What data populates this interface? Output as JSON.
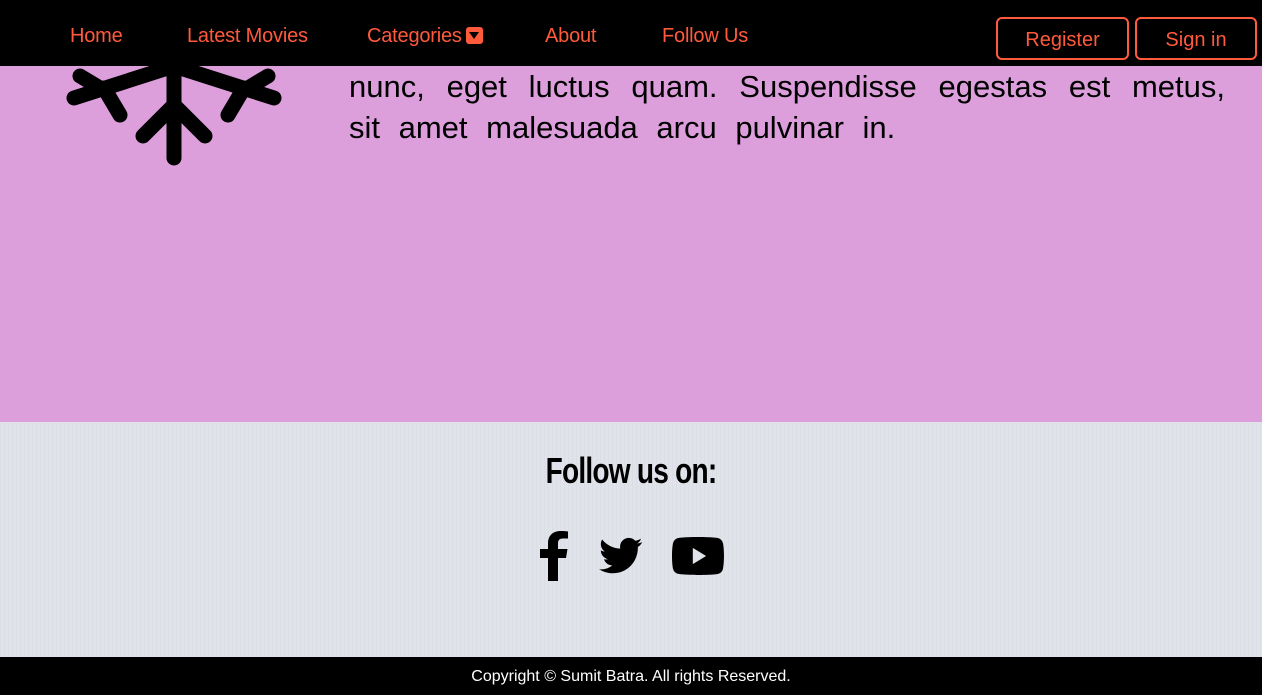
{
  "navbar": {
    "links": [
      "Home",
      "Latest Movies",
      "Categories",
      "About",
      "Follow Us"
    ],
    "register_label": "Register",
    "signin_label": "Sign in",
    "accent_color": "#ff5a3c"
  },
  "content": {
    "paragraph": "nunc, eget luctus quam. Suspendisse egestas est metus, sit amet malesuada arcu pulvinar in.",
    "icon": "snowflake-icon",
    "background_color": "#dd9edc"
  },
  "follow": {
    "title": "Follow us on:",
    "icons": [
      "facebook-icon",
      "twitter-icon",
      "youtube-icon"
    ]
  },
  "footer": {
    "copyright": "Copyright © Sumit Batra. All rights Reserved."
  }
}
